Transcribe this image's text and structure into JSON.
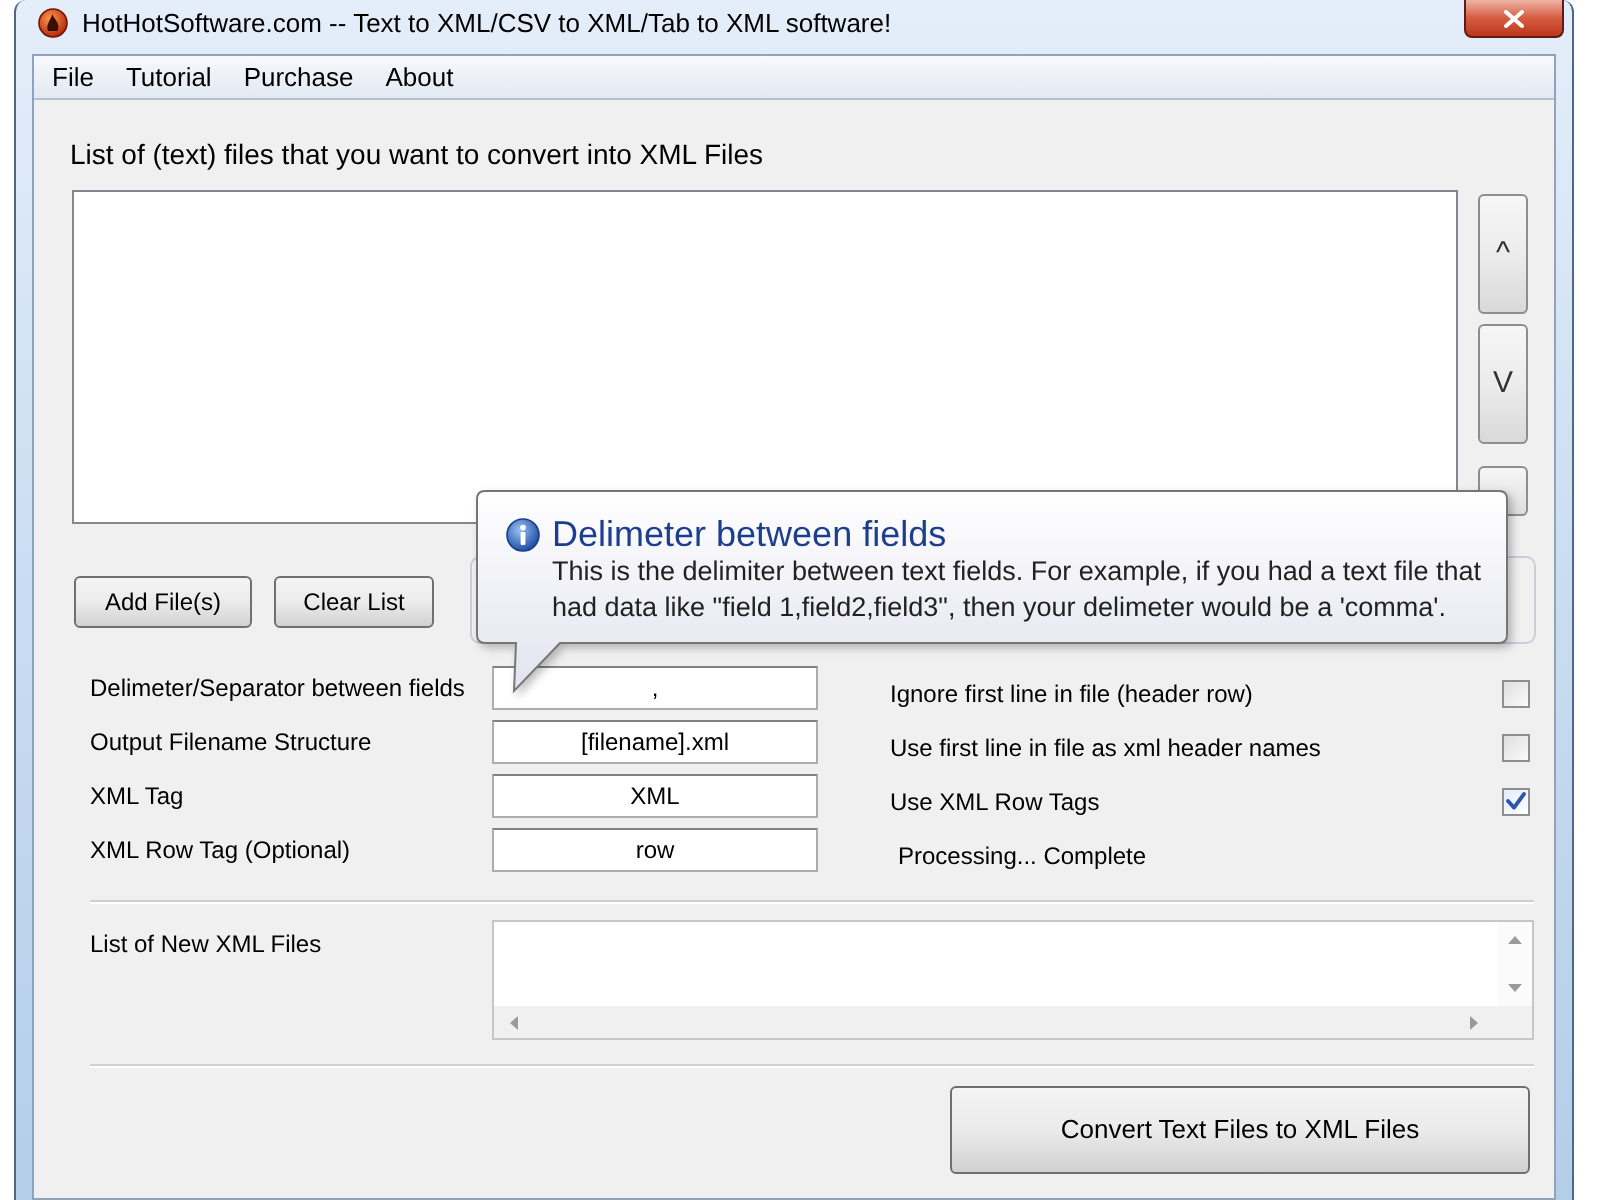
{
  "window": {
    "title": "HotHotSoftware.com -- Text to XML/CSV to XML/Tab to XML software!"
  },
  "menu": [
    {
      "label": "File"
    },
    {
      "label": "Tutorial"
    },
    {
      "label": "Purchase"
    },
    {
      "label": "About"
    }
  ],
  "file_list": {
    "label": "List of (text) files that you want to convert into XML Files",
    "side_buttons": [
      {
        "label": "^"
      },
      {
        "label": "V"
      }
    ]
  },
  "list_buttons": [
    {
      "label": "Add File(s)"
    },
    {
      "label": "Clear List"
    }
  ],
  "tooltip": {
    "title": "Delimeter between fields",
    "text": "This is the delimiter between text fields. For example, if you had a text file that\nhad data like \"field 1,field2,field3\", then your delimeter would be a 'comma'."
  },
  "settings": [
    {
      "label": "Delimeter/Separator between fields",
      "value": ","
    },
    {
      "label": "Output Filename Structure",
      "value": "[filename].xml"
    },
    {
      "label": "XML Tag",
      "value": "XML"
    },
    {
      "label": "XML Row Tag (Optional)",
      "value": "row"
    }
  ],
  "options": [
    {
      "label": "Ignore first line in file (header row)",
      "checked": false
    },
    {
      "label": "Use first line in file as xml header names",
      "checked": false
    },
    {
      "label": "Use XML Row Tags",
      "checked": true
    }
  ],
  "status": "Processing... Complete",
  "output_list": {
    "label": "List of New XML Files"
  },
  "convert_button": {
    "label": "Convert Text Files to XML Files"
  }
}
